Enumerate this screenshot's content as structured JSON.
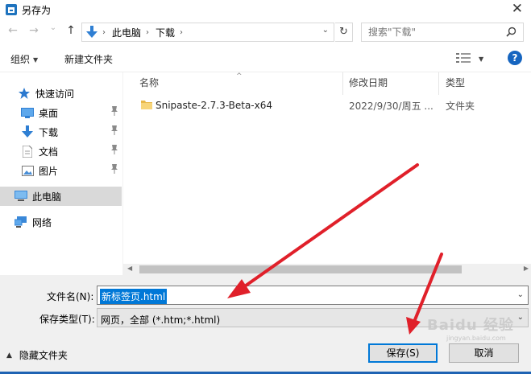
{
  "window": {
    "title": "另存为",
    "close_glyph": "✕"
  },
  "nav": {
    "back_glyph": "←",
    "forward_glyph": "→",
    "recent_glyph": "⌄",
    "up_glyph": "↑",
    "breadcrumb": [
      "此电脑",
      "下载"
    ],
    "breadcrumb_sep": "›",
    "refresh_glyph": "↻",
    "search_placeholder": "搜索\"下载\""
  },
  "toolbar": {
    "organize_label": "组织",
    "new_folder_label": "新建文件夹",
    "help_label": "?"
  },
  "sidebar": {
    "items": [
      {
        "label": "快速访问",
        "icon": "star-icon"
      },
      {
        "label": "桌面",
        "icon": "desktop-icon",
        "pinned": true
      },
      {
        "label": "下载",
        "icon": "download-icon",
        "pinned": true
      },
      {
        "label": "文档",
        "icon": "document-icon",
        "pinned": true
      },
      {
        "label": "图片",
        "icon": "picture-icon",
        "pinned": true
      },
      {
        "label": "此电脑",
        "icon": "computer-icon",
        "selected": true
      },
      {
        "label": "网络",
        "icon": "network-icon"
      }
    ],
    "pin_glyph": "📌"
  },
  "file_list": {
    "columns": [
      "名称",
      "修改日期",
      "类型"
    ],
    "sort_glyph": "^",
    "rows": [
      {
        "name": "Snipaste-2.7.3-Beta-x64",
        "date": "2022/9/30/周五 ...",
        "type": "文件夹",
        "icon": "folder-icon"
      }
    ]
  },
  "form": {
    "filename_label": "文件名(N):",
    "filename_value": "新标签页.html",
    "filetype_label": "保存类型(T):",
    "filetype_value": "网页，全部 (*.htm;*.html)",
    "hide_folders_label": "隐藏文件夹",
    "save_label": "保存(S)",
    "cancel_label": "取消"
  },
  "overlay": {
    "watermark_text": "Baidu 经验",
    "watermark_sub": "jingyan.baidu.com",
    "arrow_color": "#e0202a"
  },
  "colors": {
    "accent": "#0078d7",
    "help": "#1665c0",
    "folder": "#f2c55c"
  }
}
